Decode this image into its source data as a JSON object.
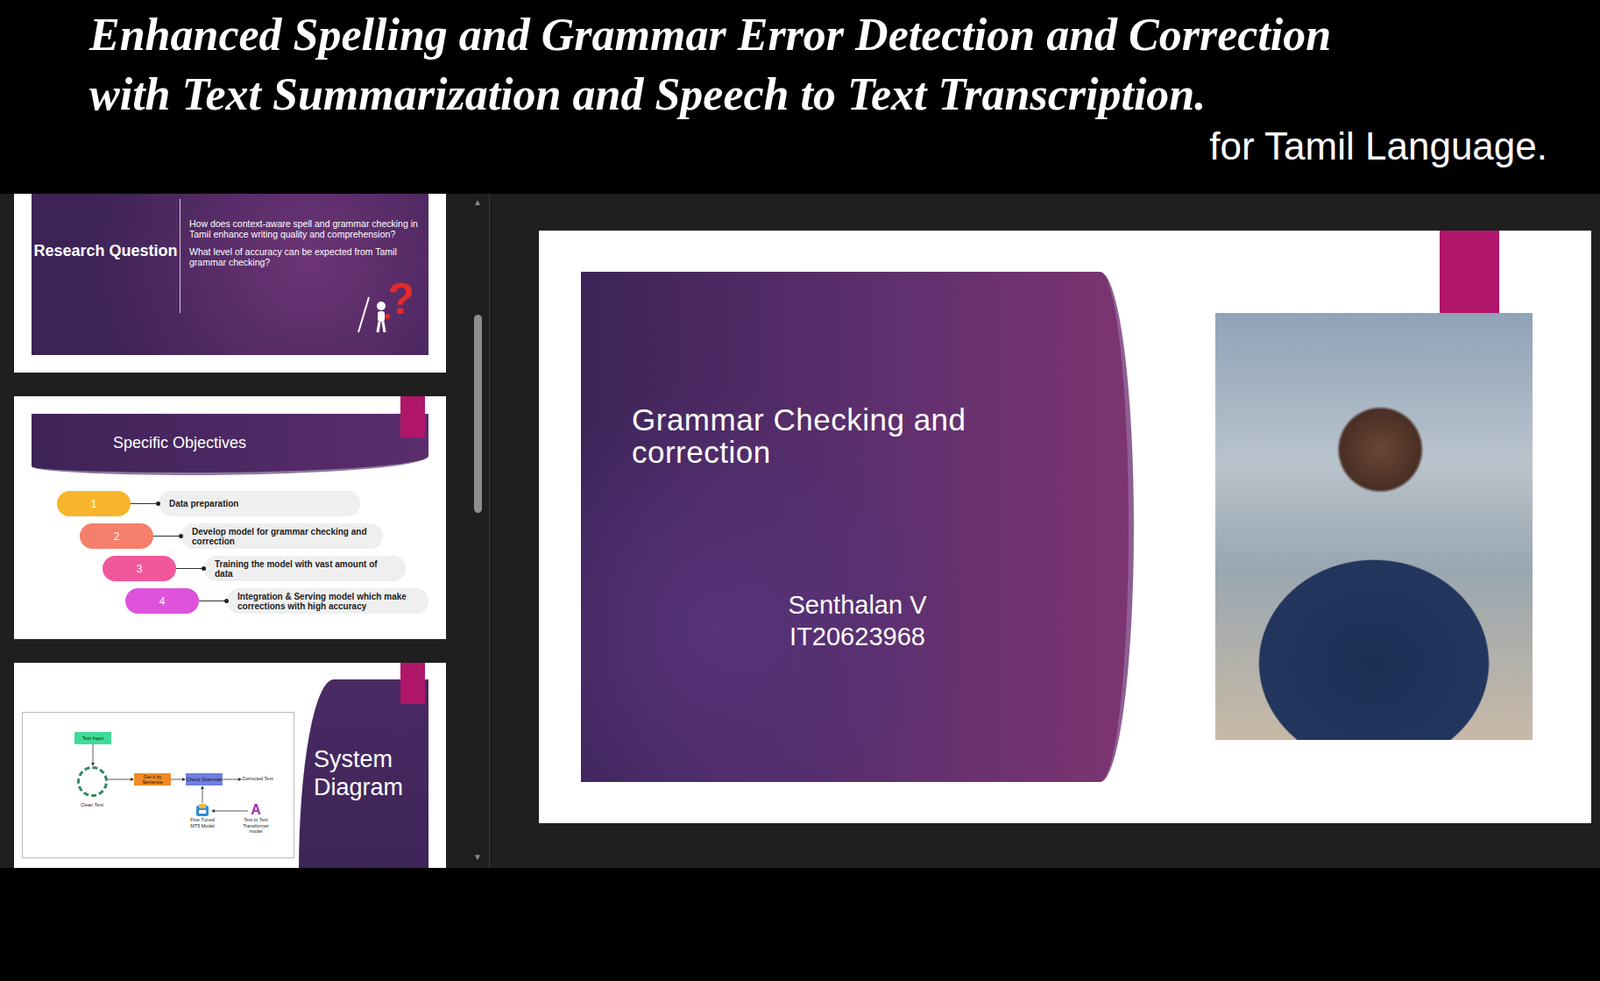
{
  "banner": {
    "title_lines": [
      "Enhanced Spelling and Grammar Error Detection and Correction",
      "with Text Summarization and Speech to Text Transcription."
    ],
    "subtitle": "for Tamil Language."
  },
  "thumbnails": [
    {
      "kind": "question",
      "title": "Research Question",
      "questions": [
        "How does context-aware spell and grammar checking in Tamil enhance writing quality and comprehension?",
        "What level of accuracy can be expected from Tamil grammar checking?"
      ],
      "icon": "?"
    },
    {
      "kind": "objectives",
      "title": "Specific Objectives",
      "steps": [
        {
          "number": "1",
          "label": "Data preparation",
          "color": "#f7b52c"
        },
        {
          "number": "2",
          "label": "Develop model for grammar checking and correction",
          "color": "#f57f6b"
        },
        {
          "number": "3",
          "label": "Training the model with vast amount of data",
          "color": "#f1579b"
        },
        {
          "number": "4",
          "label": "Integration & Serving model which make corrections with high accuracy",
          "color": "#df52dc"
        }
      ]
    },
    {
      "kind": "diagram",
      "title": "System Diagram",
      "nodes": [
        {
          "kind": "box",
          "label": "Text Input",
          "color": "#3fdc98"
        },
        {
          "kind": "circle",
          "label": "Clean Text",
          "color": "#2e8b57"
        },
        {
          "kind": "box",
          "label": "Get it by Sentence",
          "color": "#f08a24"
        },
        {
          "kind": "box",
          "label": "Check Grammar",
          "color": "#6f7fe0"
        },
        {
          "kind": "plain",
          "label": "Corrected Text"
        },
        {
          "kind": "model",
          "label": "Fine Tuned MT5 Model"
        },
        {
          "kind": "letter",
          "label": "Text to Text Transformer model",
          "icon": "A"
        }
      ]
    }
  ],
  "scrollbar": {
    "up": "▲",
    "down": "▼"
  },
  "slide": {
    "title": "Grammar Checking and correction",
    "author": "Senthalan V",
    "id": "IT20623968"
  }
}
